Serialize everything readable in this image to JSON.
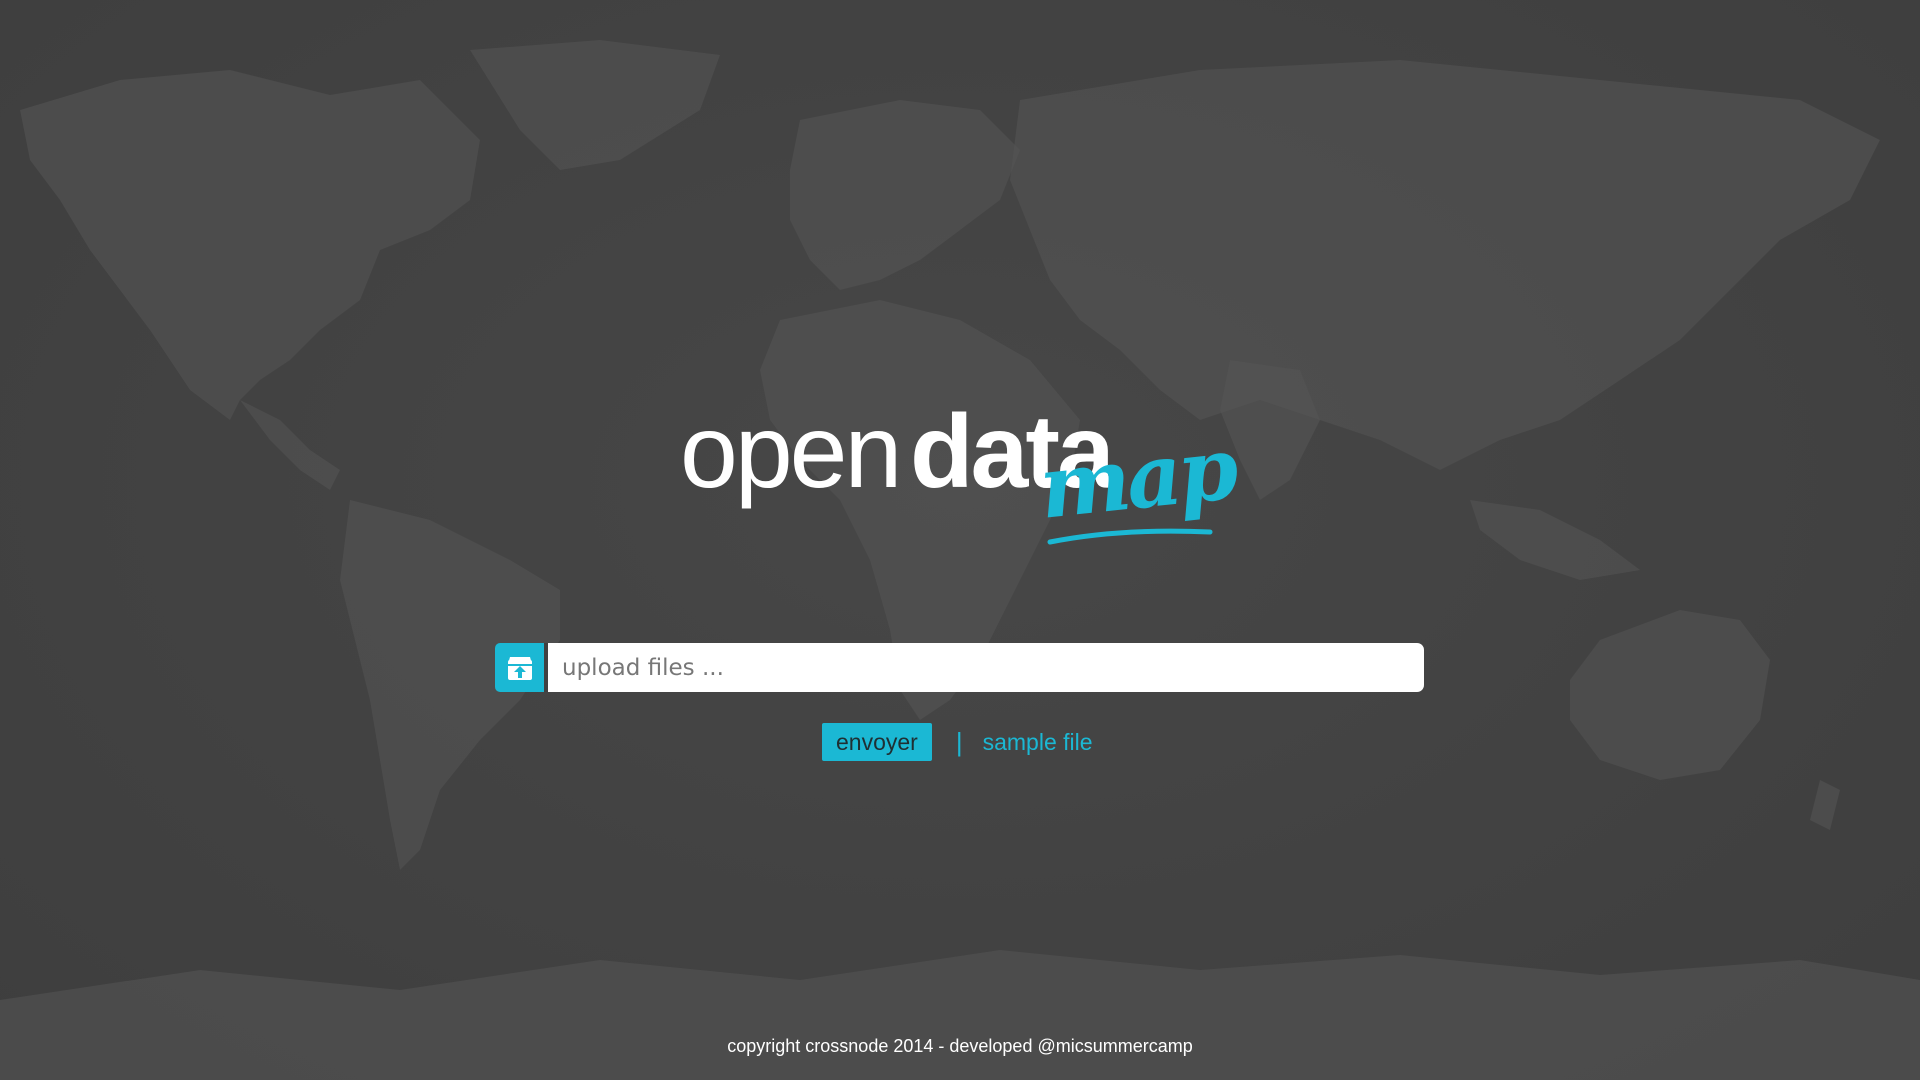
{
  "logo": {
    "word_open": "open",
    "word_data": "data",
    "word_map": "map"
  },
  "upload": {
    "icon": "upload-box-icon",
    "placeholder": "upload files ..."
  },
  "actions": {
    "send_label": "envoyer",
    "separator": "|",
    "sample_label": "sample file"
  },
  "footer": {
    "text": "copyright crossnode 2014 - developed @micsummercamp"
  },
  "colors": {
    "background": "#414141",
    "accent": "#1bb8d4",
    "map_land": "#555555",
    "text": "#ffffff"
  }
}
